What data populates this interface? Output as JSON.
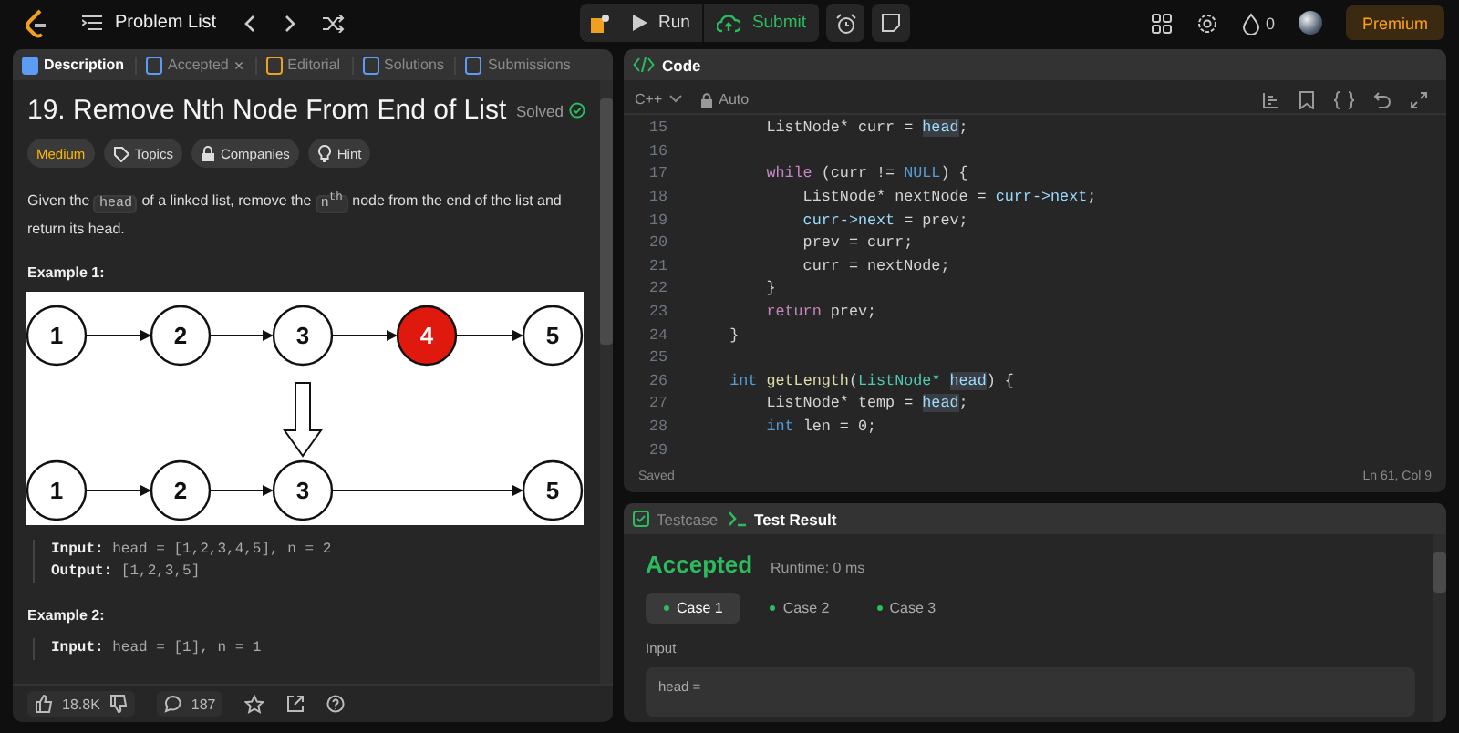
{
  "topbar": {
    "problem_list": "Problem List",
    "run": "Run",
    "submit": "Submit",
    "streak": "0",
    "premium": "Premium"
  },
  "left_tabs": [
    {
      "label": "Description",
      "selected": true
    },
    {
      "label": "Accepted",
      "selected": false,
      "close": "×"
    },
    {
      "label": "Editorial",
      "selected": false
    },
    {
      "label": "Solutions",
      "selected": false
    },
    {
      "label": "Submissions",
      "selected": false
    }
  ],
  "problem": {
    "title": "19. Remove Nth Node From End of List",
    "status": "Solved",
    "difficulty": "Medium",
    "tags": [
      "Topics",
      "Companies",
      "Hint"
    ],
    "description": [
      {
        "kind": "text",
        "text": "Given the "
      },
      {
        "kind": "code",
        "text": "head"
      },
      {
        "kind": "text",
        "text": " of a linked list, remove the "
      },
      {
        "kind": "code",
        "text": "n$^{th}$"
      },
      {
        "kind": "text",
        "text": " node from the end of the list and return its head."
      }
    ],
    "examples": [
      {
        "title": "Example 1:",
        "lines": [
          "**Input:** head = [1,2,3,4,5], n = 2",
          "**Output:** [1,2,3,5]"
        ]
      },
      {
        "title": "Example 2:",
        "lines": [
          "**Input:** head = [1], n = 1"
        ]
      }
    ]
  },
  "diagram": {
    "before": [
      {
        "label": "1",
        "removed": false
      },
      {
        "label": "2",
        "removed": false
      },
      {
        "label": "3",
        "removed": false
      },
      {
        "label": "4",
        "removed": true
      },
      {
        "label": "5",
        "removed": false
      }
    ],
    "after": [
      {
        "kind": "node",
        "label": "1"
      },
      {
        "kind": "node",
        "label": "2"
      },
      {
        "kind": "node",
        "label": "3"
      },
      {
        "kind": "gap"
      },
      {
        "kind": "node",
        "label": "5"
      }
    ]
  },
  "footer": {
    "likes": "18.8K",
    "comments": "187"
  },
  "code_panel": {
    "title": "Code",
    "language": "C++",
    "mode": "Auto",
    "status": "Saved",
    "cursor": "Ln 61, Col 9",
    "lines": [
      {
        "num": "15",
        "tokens": [
          {
            "t": "        ListNode* curr = ",
            "kind": "plain"
          },
          {
            "t": "head",
            "kind": "match"
          },
          {
            "t": ";",
            "kind": "plain"
          }
        ]
      },
      {
        "num": "16"
      },
      {
        "num": "17",
        "tokens": [
          {
            "t": "        while",
            "kind": "keyword"
          },
          {
            "t": " (curr != ",
            "kind": "plain"
          },
          {
            "t": "NULL",
            "kind": "type"
          },
          {
            "t": ") {",
            "kind": "plain"
          }
        ]
      },
      {
        "num": "18",
        "tokens": [
          {
            "t": "            ListNode* nextNode = ",
            "kind": "plain"
          },
          {
            "t": "curr->next",
            "kind": "var"
          },
          {
            "t": ";",
            "kind": "plain"
          }
        ]
      },
      {
        "num": "19",
        "tokens": [
          {
            "t": "            curr->next",
            "kind": "var"
          },
          {
            "t": " = prev;",
            "kind": "plain"
          }
        ]
      },
      {
        "num": "20",
        "tokens": [
          {
            "t": "            prev = curr;",
            "kind": "plain"
          }
        ]
      },
      {
        "num": "21",
        "tokens": [
          {
            "t": "            curr = nextNode;",
            "kind": "plain"
          }
        ]
      },
      {
        "num": "22",
        "tokens": [
          {
            "t": "        }",
            "kind": "plain"
          }
        ]
      },
      {
        "num": "23",
        "tokens": [
          {
            "t": "        return",
            "kind": "keyword"
          },
          {
            "t": " prev;",
            "kind": "plain"
          }
        ]
      },
      {
        "num": "24",
        "tokens": [
          {
            "t": "    }",
            "kind": "plain"
          }
        ]
      },
      {
        "num": "25"
      },
      {
        "num": "26",
        "tokens": [
          {
            "t": "    int",
            "kind": "type"
          },
          {
            "t": " getLength",
            "kind": "func"
          },
          {
            "t": "(",
            "kind": "plain"
          },
          {
            "t": "ListNode* ",
            "kind": "class"
          },
          {
            "t": "head",
            "kind": "match"
          },
          {
            "t": ") {",
            "kind": "plain"
          }
        ]
      },
      {
        "num": "27",
        "tokens": [
          {
            "t": "        ListNode* temp = ",
            "kind": "plain"
          },
          {
            "t": "head",
            "kind": "match"
          },
          {
            "t": ";",
            "kind": "plain"
          }
        ]
      },
      {
        "num": "28",
        "tokens": [
          {
            "t": "        int",
            "kind": "type"
          },
          {
            "t": " len = 0;",
            "kind": "plain"
          }
        ]
      },
      {
        "num": "29"
      }
    ]
  },
  "result_panel": {
    "tabs": [
      {
        "label": "Testcase",
        "selected": false
      },
      {
        "label": "Test Result",
        "selected": true
      }
    ],
    "verdict": "Accepted",
    "runtime": "Runtime: 0 ms",
    "cases": [
      {
        "label": "Case 1",
        "selected": true
      },
      {
        "label": "Case 2",
        "selected": false
      },
      {
        "label": "Case 3",
        "selected": false
      }
    ],
    "input_label": "Input",
    "input_var": "head ="
  }
}
